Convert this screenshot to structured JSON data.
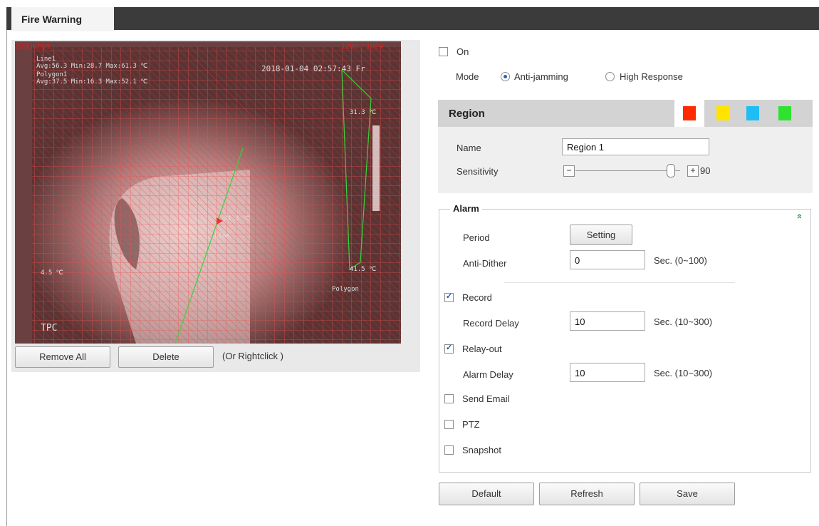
{
  "tab": {
    "title": "Fire Warning"
  },
  "video": {
    "bitrate": "2030Kbps",
    "resolution": "1280 * 1024",
    "timestamp": "2018-01-04 02:57:43 Fr",
    "osd_line1": "Line1",
    "osd_line1_stats": "Avg:56.3 Min:28.7 Max:61.3 ℃",
    "osd_polygon": "Polygon1",
    "osd_polygon_stats": "Avg:37.5 Min:16.3 Max:52.1 ℃",
    "point_label": "31.3 ℃",
    "point_label2": "41.5 ℃",
    "point_label3": "4.5 ℃",
    "hot_label": "31.3 ℃",
    "line_label": "Line",
    "polygon_label": "Polygon",
    "brand": "TPC"
  },
  "video_controls": {
    "remove_all": "Remove All",
    "delete": "Delete",
    "hint": "(Or Rightclick )"
  },
  "enable": {
    "label": "On",
    "checked": false
  },
  "mode": {
    "label": "Mode",
    "options": [
      "Anti-jamming",
      "High Response"
    ],
    "selected": "Anti-jamming"
  },
  "region": {
    "title": "Region",
    "colors": [
      "#ff2a00",
      "#ffe400",
      "#1ebef5",
      "#2fe22f"
    ],
    "name_label": "Name",
    "name_value": "Region 1",
    "sensitivity_label": "Sensitivity",
    "sensitivity_value": "90",
    "sensitivity_minus": "−",
    "sensitivity_plus": "+"
  },
  "alarm": {
    "title": "Alarm",
    "collapse_icon": "»",
    "period_label": "Period",
    "period_button": "Setting",
    "anti_dither_label": "Anti-Dither",
    "anti_dither_value": "0",
    "anti_dither_unit": "Sec. (0~100)",
    "record_label": "Record",
    "record_checked": true,
    "record_delay_label": "Record Delay",
    "record_delay_value": "10",
    "record_delay_unit": "Sec. (10~300)",
    "relay_label": "Relay-out",
    "relay_checked": true,
    "alarm_delay_label": "Alarm Delay",
    "alarm_delay_value": "10",
    "alarm_delay_unit": "Sec. (10~300)",
    "send_email_label": "Send Email",
    "send_email_checked": false,
    "ptz_label": "PTZ",
    "ptz_checked": false,
    "snapshot_label": "Snapshot",
    "snapshot_checked": false
  },
  "footer": {
    "default": "Default",
    "refresh": "Refresh",
    "save": "Save"
  }
}
